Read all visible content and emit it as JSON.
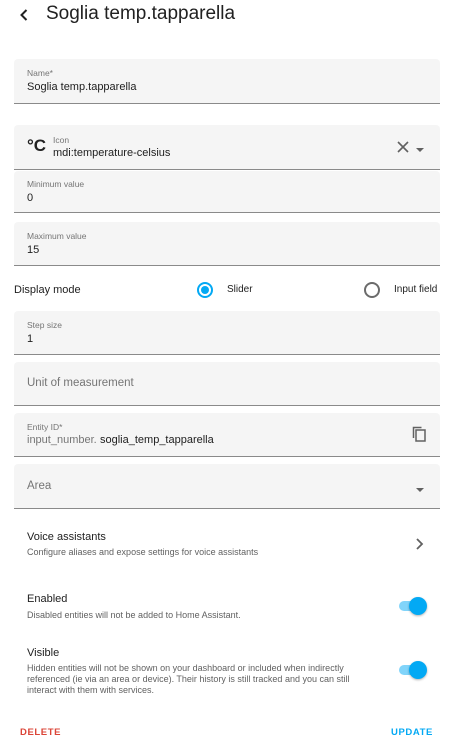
{
  "header": {
    "title": "Soglia temp.tapparella"
  },
  "name_field": {
    "label": "Name*",
    "value": "Soglia temp.tapparella"
  },
  "icon_field": {
    "glyph": "°C",
    "label": "Icon",
    "value": "mdi:temperature-celsius",
    "icon": "temperature-celsius-icon"
  },
  "min_field": {
    "label": "Minimum value",
    "value": "0"
  },
  "max_field": {
    "label": "Maximum value",
    "value": "15"
  },
  "display_mode": {
    "label": "Display mode",
    "options": [
      {
        "label": "Slider",
        "checked": true
      },
      {
        "label": "Input field",
        "checked": false
      }
    ]
  },
  "step_field": {
    "label": "Step size",
    "value": "1"
  },
  "unit_field": {
    "placeholder": "Unit of measurement"
  },
  "entity_field": {
    "label": "Entity ID*",
    "prefix": "input_number.",
    "value": "soglia_temp_tapparella"
  },
  "area_field": {
    "placeholder": "Area"
  },
  "voice": {
    "title": "Voice assistants",
    "subtitle": "Configure aliases and expose settings for voice assistants"
  },
  "enabled": {
    "title": "Enabled",
    "subtitle": "Disabled entities will not be added to Home Assistant.",
    "on": true
  },
  "visible": {
    "title": "Visible",
    "subtitle": "Hidden entities will not be shown on your dashboard or included when indirectly referenced (ie via an area or device). Their history is still tracked and you can still interact with them with services.",
    "on": true
  },
  "footer": {
    "delete_label": "DELETE",
    "update_label": "UPDATE"
  },
  "colors": {
    "accent": "#03a9f4",
    "danger": "#db4437",
    "field_bg": "#f5f5f5"
  }
}
